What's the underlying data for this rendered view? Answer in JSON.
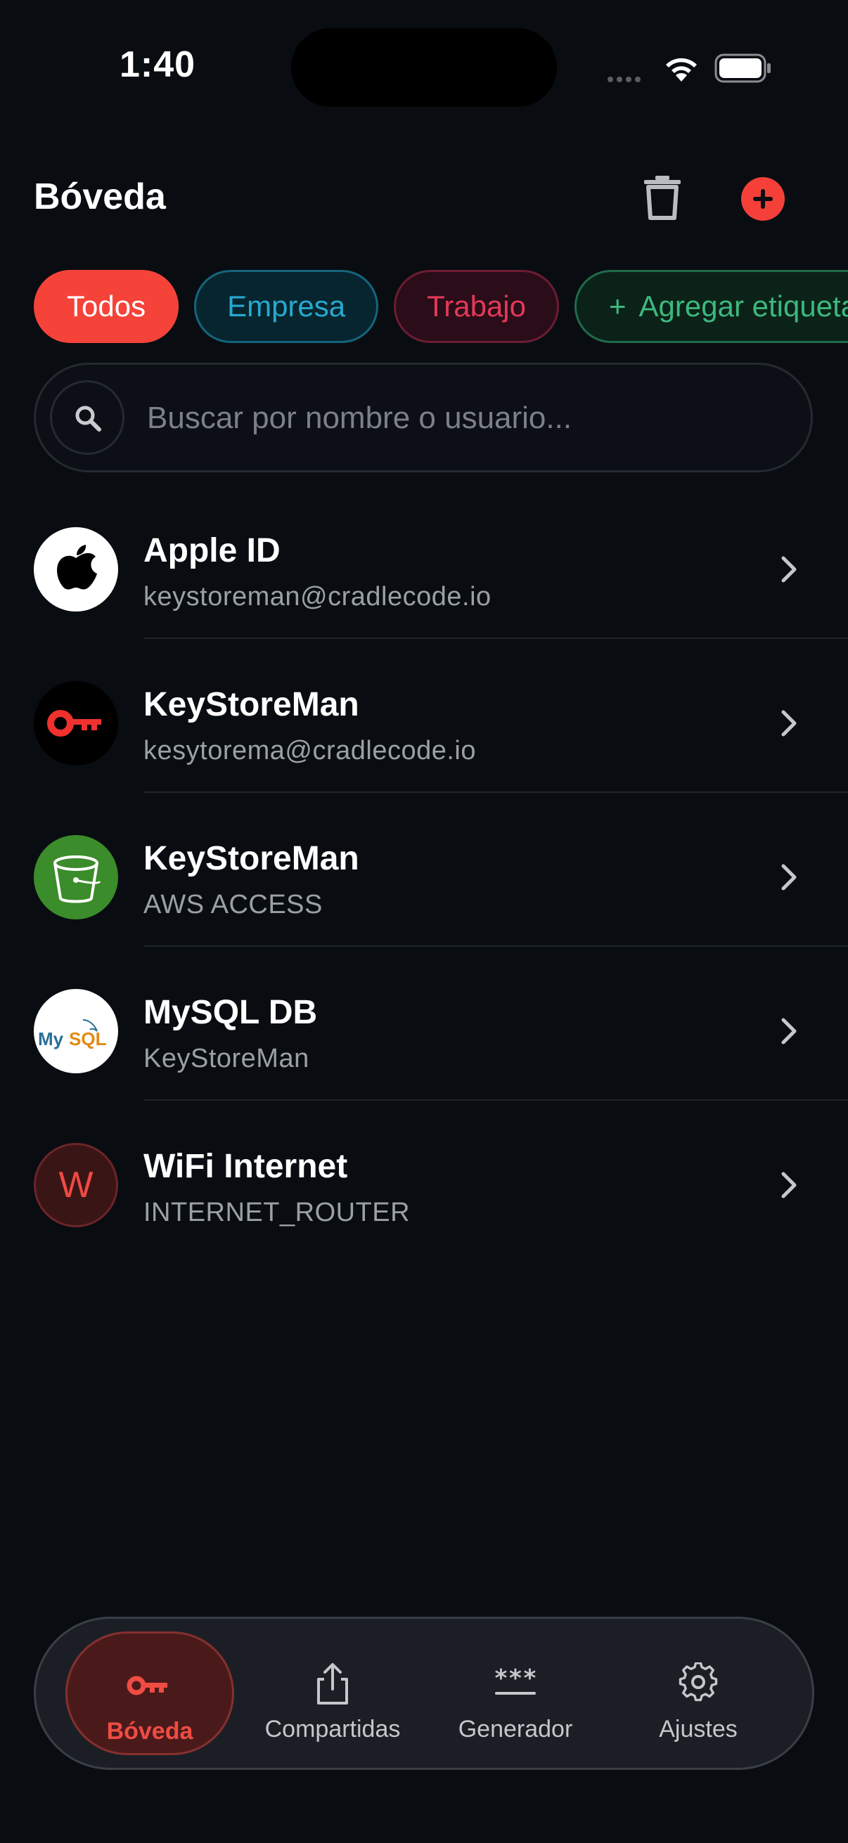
{
  "status": {
    "time": "1:40"
  },
  "header": {
    "title": "Bóveda"
  },
  "chips": [
    {
      "label": "Todos"
    },
    {
      "label": "Empresa"
    },
    {
      "label": "Trabajo"
    },
    {
      "label": "Agregar etiqueta"
    }
  ],
  "search": {
    "placeholder": "Buscar por nombre o usuario..."
  },
  "items": [
    {
      "name": "Apple ID",
      "subtitle": "keystoreman@cradlecode.io",
      "icon": "apple-icon"
    },
    {
      "name": "KeyStoreMan",
      "subtitle": "kesytorema@cradlecode.io",
      "icon": "key-icon"
    },
    {
      "name": "KeyStoreMan",
      "subtitle": "AWS ACCESS",
      "icon": "aws-bucket-icon"
    },
    {
      "name": "MySQL DB",
      "subtitle": "KeyStoreMan",
      "icon": "mysql-logo"
    },
    {
      "name": "WiFi Internet",
      "subtitle": "INTERNET_ROUTER",
      "icon": "letter-avatar",
      "letter": "W"
    }
  ],
  "tabs": [
    {
      "label": "Bóveda",
      "icon": "key-icon"
    },
    {
      "label": "Compartidas",
      "icon": "share-icon"
    },
    {
      "label": "Generador",
      "icon": "password-generator-icon"
    },
    {
      "label": "Ajustes",
      "icon": "gear-icon"
    }
  ],
  "colors": {
    "accent": "#f5403a",
    "background": "#090d12"
  }
}
